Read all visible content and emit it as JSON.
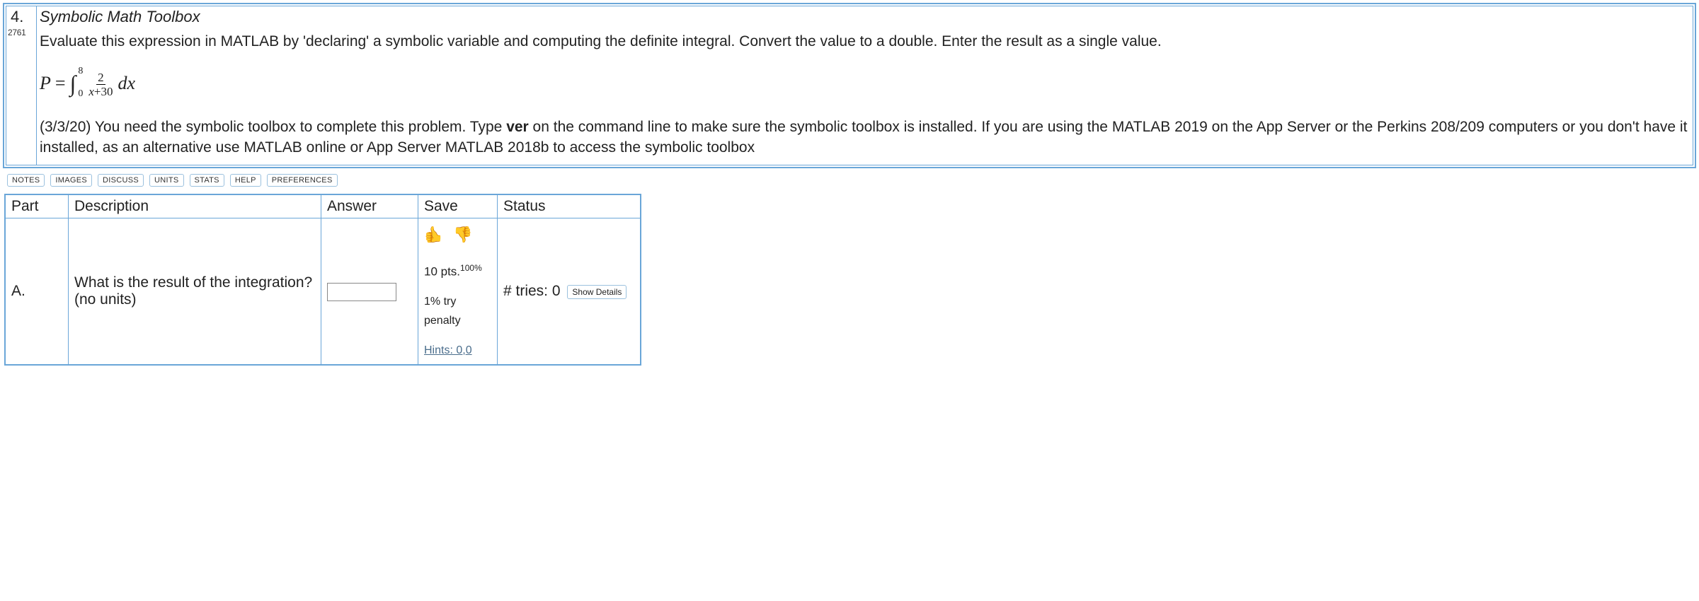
{
  "question": {
    "number": "4.",
    "id": "2761",
    "title": "Symbolic Math Toolbox",
    "instructions": "Evaluate this expression in MATLAB by 'declaring' a symbolic variable and computing the definite integral. Convert the value to a double. Enter the result as a single value.",
    "equation": {
      "lhs": "P",
      "eq": "=",
      "int_upper": "8",
      "int_lower": "0",
      "frac_top": "2",
      "frac_bot_var": "x",
      "frac_bot_plus": "+30",
      "dx": "dx"
    },
    "note_pre": "(3/3/20) You need the symbolic toolbox to complete this problem. Type ",
    "note_bold": "ver",
    "note_post": " on the command line to make sure the symbolic toolbox is installed. If you are using the MATLAB 2019 on the App Server or the Perkins 208/209 computers or you don't have it installed, as an alternative use MATLAB online or App Server MATLAB 2018b to access the symbolic toolbox"
  },
  "links": {
    "notes": "NOTES",
    "images": "IMAGES",
    "discuss": "DISCUSS",
    "units": "UNITS",
    "stats": "STATS",
    "help": "HELP",
    "preferences": "PREFERENCES"
  },
  "table": {
    "headers": {
      "part": "Part",
      "description": "Description",
      "answer": "Answer",
      "save": "Save",
      "status": "Status"
    },
    "row": {
      "part": "A.",
      "description": "What is the result of the integration? (no units)",
      "answer_value": "",
      "save": {
        "pts_label": "10 pts.",
        "pts_pct": "100%",
        "penalty": "1% try penalty",
        "hints": "Hints: 0,0"
      },
      "status": {
        "tries_label": "# tries: 0",
        "details_btn": "Show Details"
      }
    }
  }
}
